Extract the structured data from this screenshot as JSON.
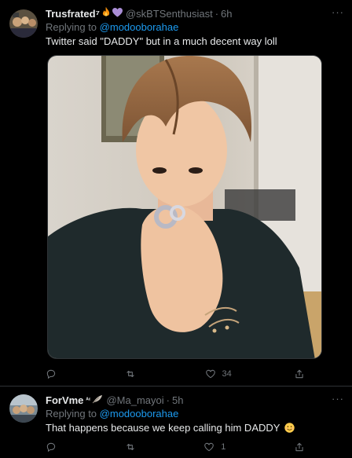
{
  "tweets": [
    {
      "display_name": "Trusfrated⁷",
      "handle": "@skBTSenthusiast",
      "separator": "·",
      "time": "6h",
      "replying_prefix": "Replying to",
      "replying_to": "@modooborahae",
      "text": "Twitter said \"DADDY\" but in a much decent way loll",
      "more": "···",
      "media_icons": [
        "fire-emoji",
        "purple-heart-emoji"
      ],
      "reply_count": "",
      "retweet_count": "",
      "like_count": "34"
    },
    {
      "display_name": "ForVme",
      "display_name_badge": "ᴬᶜ",
      "handle": "@Ma_mayoi",
      "separator": "·",
      "time": "5h",
      "replying_prefix": "Replying to",
      "replying_to": "@modooborahae",
      "text": "That happens because we keep calling him DADDY",
      "more": "···",
      "like_count": "1"
    }
  ],
  "colors": {
    "background": "#000000",
    "text": "#e7e9ea",
    "muted": "#71767b",
    "accent": "#1d9bf0",
    "border": "#2f3336"
  }
}
